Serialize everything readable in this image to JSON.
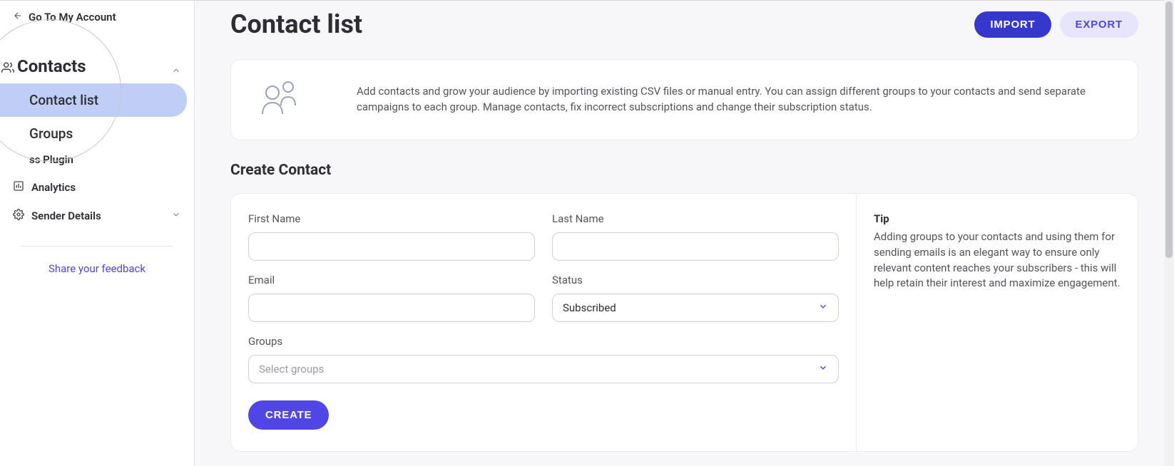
{
  "sidebar": {
    "go_back": "Go To My Account",
    "contacts_label": "Contacts",
    "items": {
      "contact_list": "Contact list",
      "groups": "Groups",
      "plugin": "ss Plugin",
      "analytics": "Analytics",
      "sender_details": "Sender Details"
    },
    "feedback": "Share your feedback"
  },
  "header": {
    "title": "Contact list",
    "import": "IMPORT",
    "export": "EXPORT"
  },
  "info": {
    "text": "Add contacts and grow your audience by importing existing CSV files or manual entry. You can assign different groups to your contacts and send separate campaigns to each group. Manage contacts, fix incorrect subscriptions and change their subscription status."
  },
  "create": {
    "section_title": "Create Contact",
    "first_name_label": "First Name",
    "last_name_label": "Last Name",
    "email_label": "Email",
    "status_label": "Status",
    "status_value": "Subscribed",
    "groups_label": "Groups",
    "groups_placeholder": "Select groups",
    "create_btn": "CREATE"
  },
  "tip": {
    "title": "Tip",
    "text": "Adding groups to your contacts and using them for sending emails is an elegant way to ensure only relevant content reaches your subscribers - this will help retain their interest and maximize engagement."
  }
}
